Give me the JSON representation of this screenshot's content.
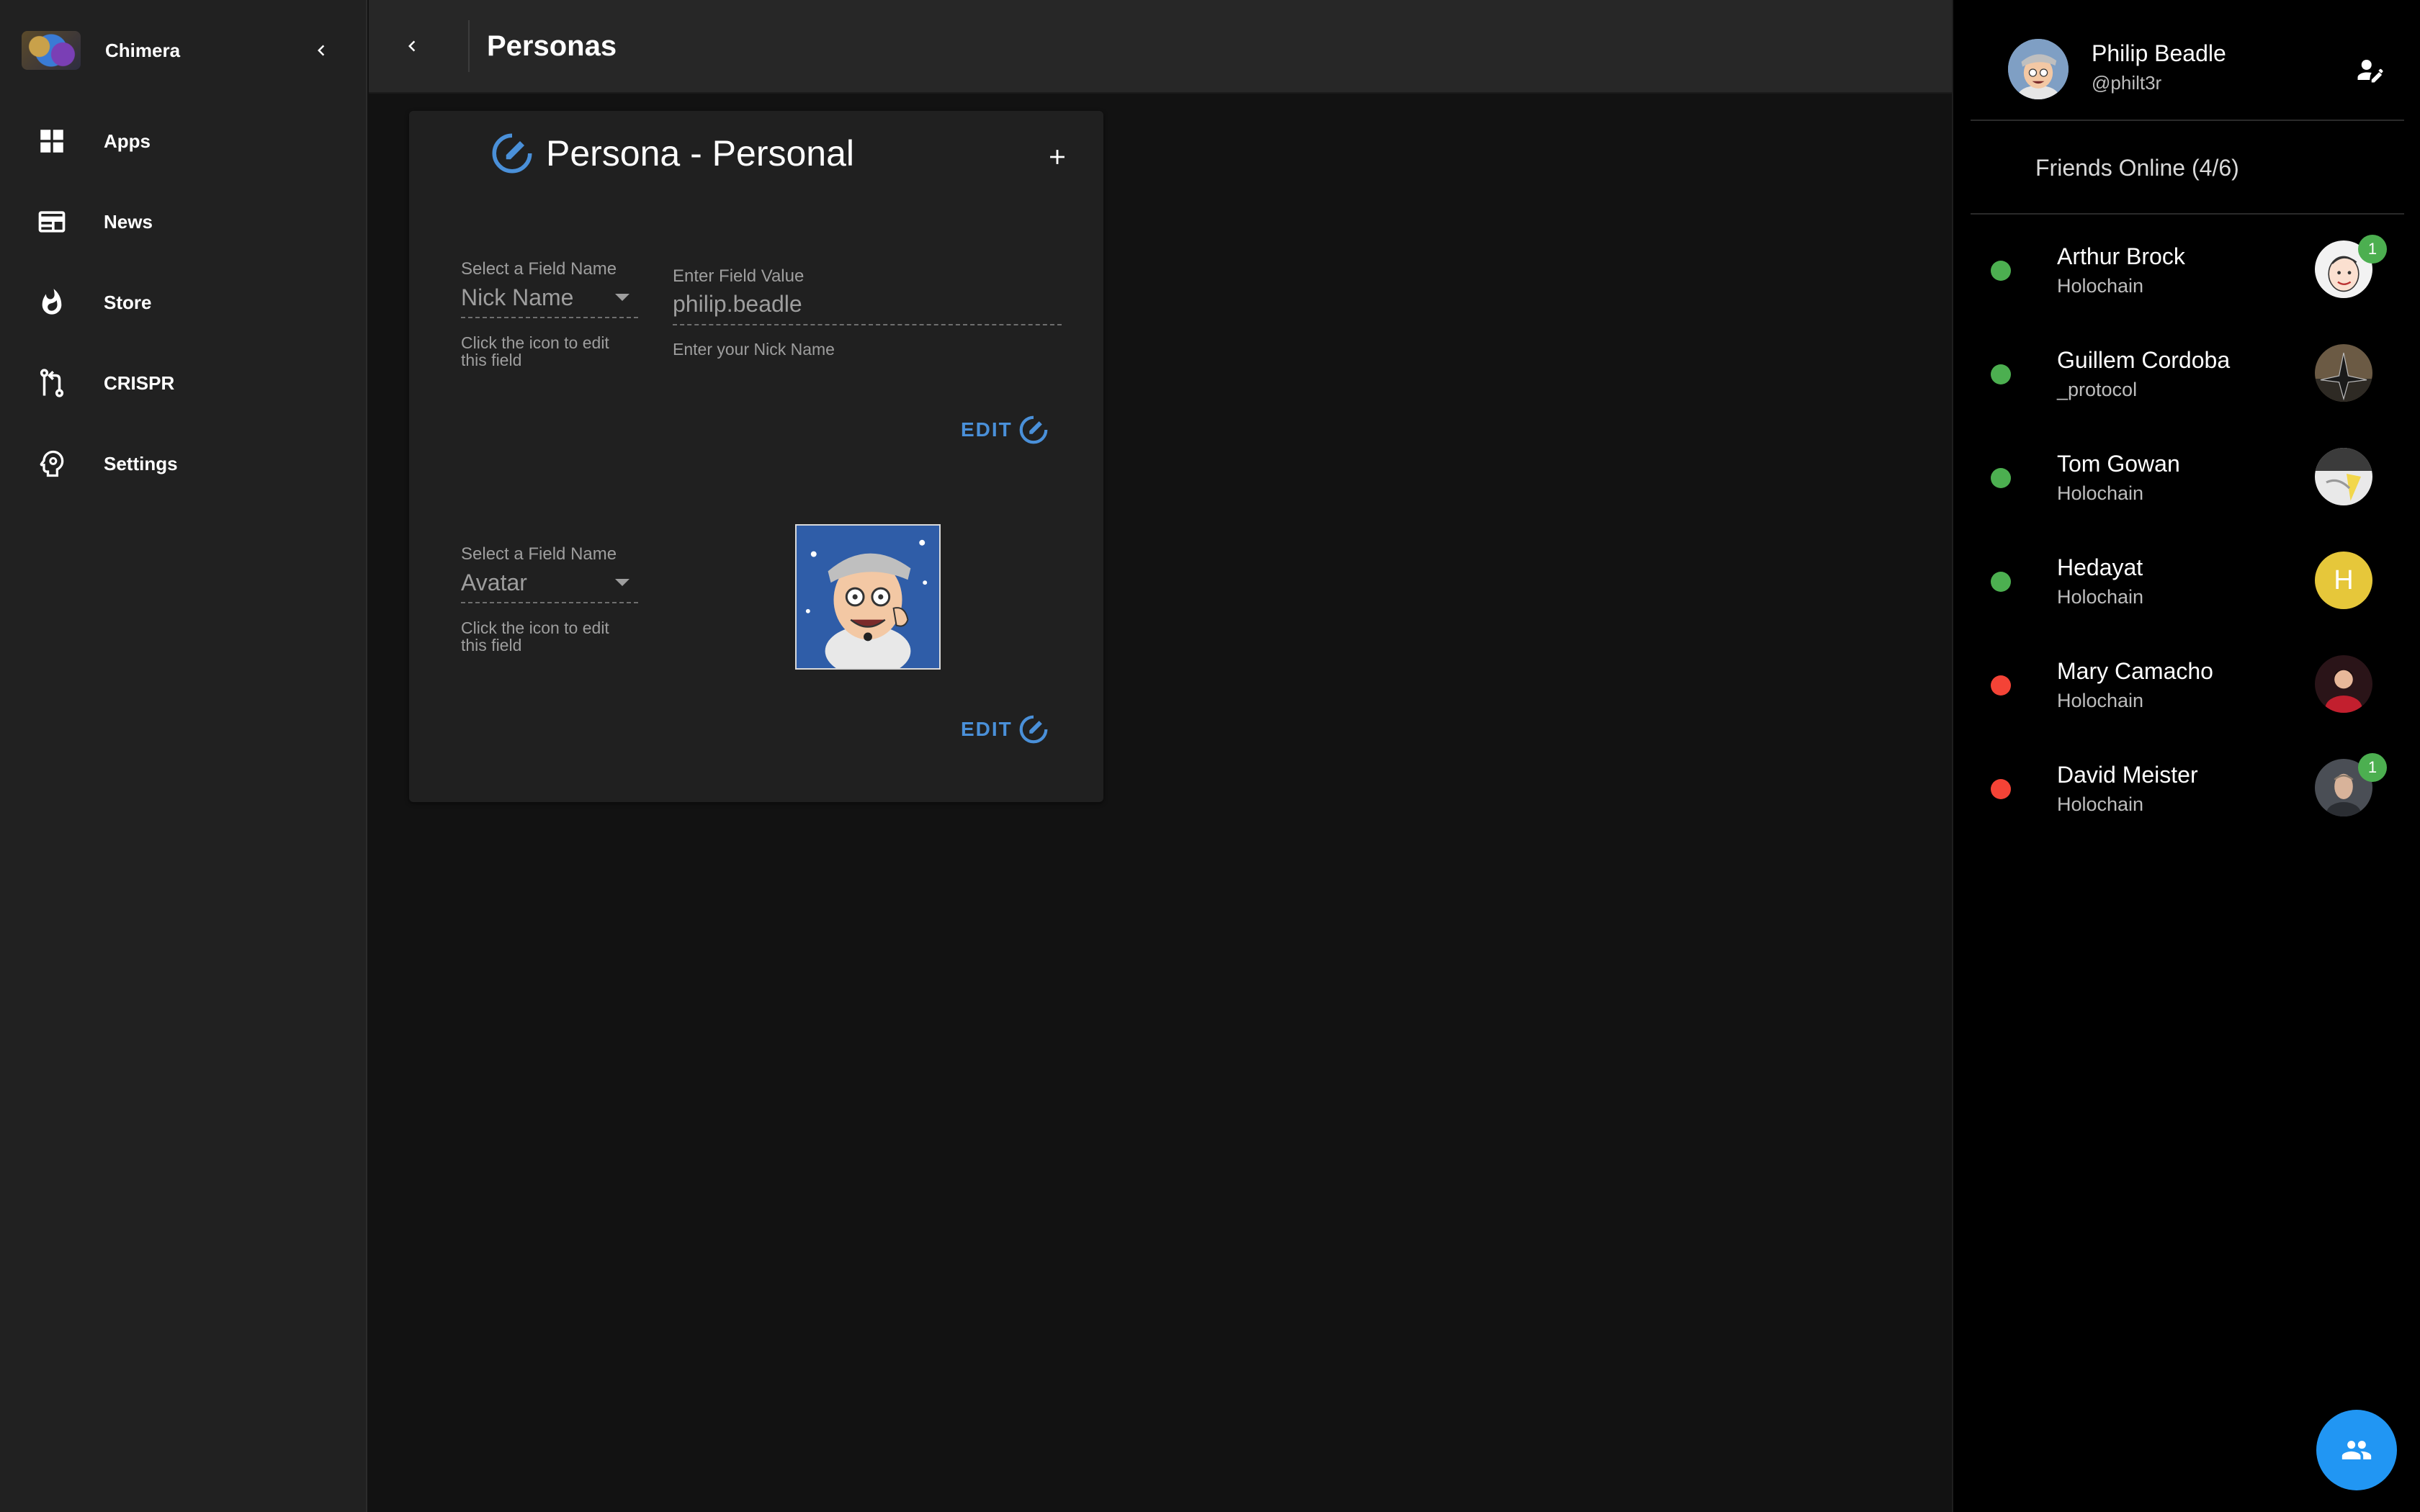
{
  "drawer": {
    "app_name": "Chimera",
    "logo_icon": "chimera-logo",
    "items": [
      {
        "label": "Apps",
        "icon": "grid-icon"
      },
      {
        "label": "News",
        "icon": "newspaper-icon"
      },
      {
        "label": "Store",
        "icon": "flame-icon"
      },
      {
        "label": "CRISPR",
        "icon": "merge-icon"
      },
      {
        "label": "Settings",
        "icon": "head-gear-icon"
      }
    ]
  },
  "topbar": {
    "title": "Personas"
  },
  "persona_card": {
    "title": "Persona - Personal",
    "fields": [
      {
        "select_label": "Select a Field Name",
        "select_value": "Nick Name",
        "select_helper": "Click the icon to edit this field",
        "value_label": "Enter Field Value",
        "value": "philip.beadle",
        "value_helper": "Enter your Nick Name",
        "edit_label": "EDIT"
      },
      {
        "select_label": "Select a Field Name",
        "select_value": "Avatar",
        "select_helper": "Click the icon to edit this field",
        "edit_label": "EDIT"
      }
    ]
  },
  "profile": {
    "name": "Philip Beadle",
    "handle": "@philt3r"
  },
  "friends": {
    "header": "Friends Online (4/6)",
    "list": [
      {
        "name": "Arthur Brock",
        "org": "Holochain",
        "status": "online",
        "status_color": "#4caf50",
        "badge": "1"
      },
      {
        "name": "Guillem Cordoba",
        "org": "_protocol",
        "status": "online",
        "status_color": "#4caf50"
      },
      {
        "name": "Tom Gowan",
        "org": "Holochain",
        "status": "online",
        "status_color": "#4caf50"
      },
      {
        "name": "Hedayat",
        "org": "Holochain",
        "status": "online",
        "status_color": "#4caf50",
        "initial": "H"
      },
      {
        "name": "Mary Camacho",
        "org": "Holochain",
        "status": "offline",
        "status_color": "#f44336"
      },
      {
        "name": "David Meister",
        "org": "Holochain",
        "status": "offline",
        "status_color": "#f44336",
        "badge": "1"
      }
    ]
  },
  "colors": {
    "accent": "#4a90d9",
    "fab": "#2196f3",
    "online": "#4caf50",
    "offline": "#f44336"
  }
}
